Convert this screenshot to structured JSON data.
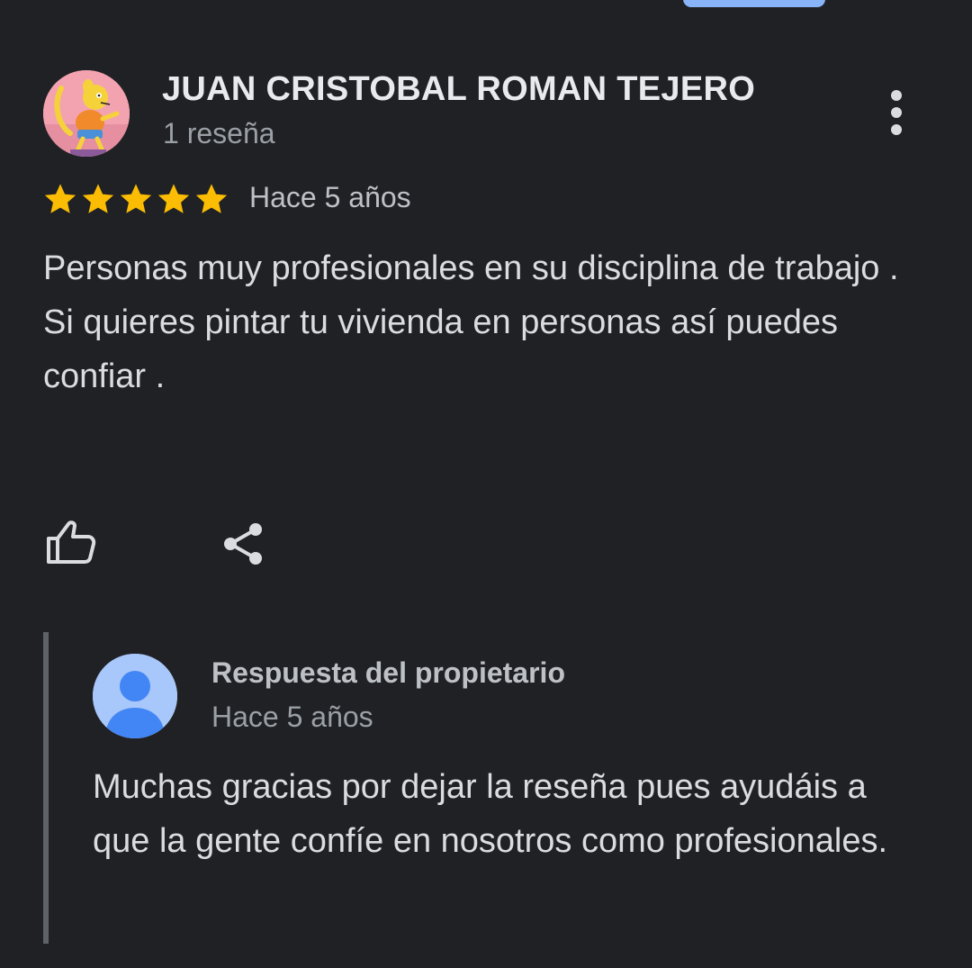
{
  "review": {
    "reviewer_name": "JUAN CRISTOBAL ROMAN TEJERO",
    "review_count": "1 reseña",
    "rating": 5,
    "max_rating": 5,
    "date": "Hace 5 años",
    "text": "Personas muy profesionales en su disciplina de trabajo .\nSi quieres pintar tu vivienda en personas así puedes confiar ."
  },
  "owner_response": {
    "title": "Respuesta del propietario",
    "date": "Hace 5 años",
    "text": "Muchas gracias por dejar la reseña pues ayudáis a que la gente confíe en nosotros como profesionales."
  },
  "icons": {
    "more": "more-vert-icon",
    "like": "thumb-up-icon",
    "share": "share-icon",
    "star": "star-icon"
  },
  "colors": {
    "background": "#202124",
    "star": "#fbbc04",
    "accent": "#8ab4f8",
    "default_avatar_bg": "#a8c7fa",
    "default_avatar_fg": "#4285f4"
  }
}
